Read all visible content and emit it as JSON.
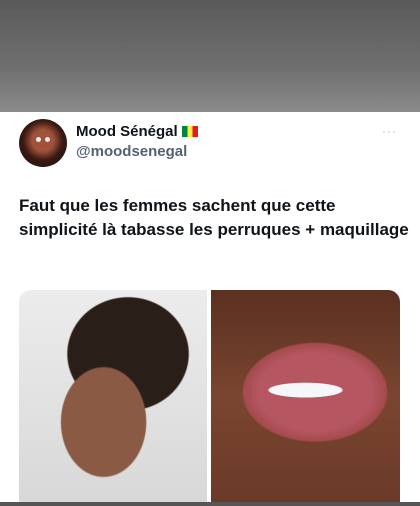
{
  "tweet": {
    "author_name": "Mood Sénégal",
    "flag_icon": "senegal-flag",
    "handle": "@moodsenegal",
    "more_label": "···",
    "text": "Faut que les femmes sachent que cette simplicité là tabasse les perruques + maquillage"
  },
  "colors": {
    "text": "#0f1419",
    "muted": "#536471"
  }
}
